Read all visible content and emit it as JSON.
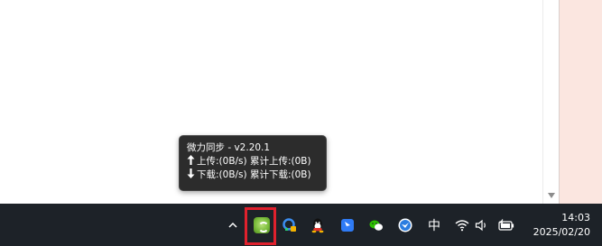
{
  "tooltip": {
    "title": "微力同步 - v2.20.1",
    "upload": "上传:(0B/s) 累计上传:(0B)",
    "download": "下载:(0B/s) 累计下载:(0B)",
    "upload_arrow": "🡑",
    "download_arrow": "🡓"
  },
  "taskbar": {
    "chevron": "^",
    "ime_label": "中",
    "time": "14:03",
    "date": "2025/02/20",
    "tray_icons": [
      "weili-sync-icon",
      "browser-app-icon",
      "qq-icon",
      "feishu-icon",
      "wechat-icon",
      "bluebird-app-icon"
    ]
  },
  "colors": {
    "taskbar_bg": "#1d2228",
    "tooltip_bg": "#2c2c2c",
    "highlight": "#e0212d",
    "side_panel": "#fbe6e0"
  }
}
